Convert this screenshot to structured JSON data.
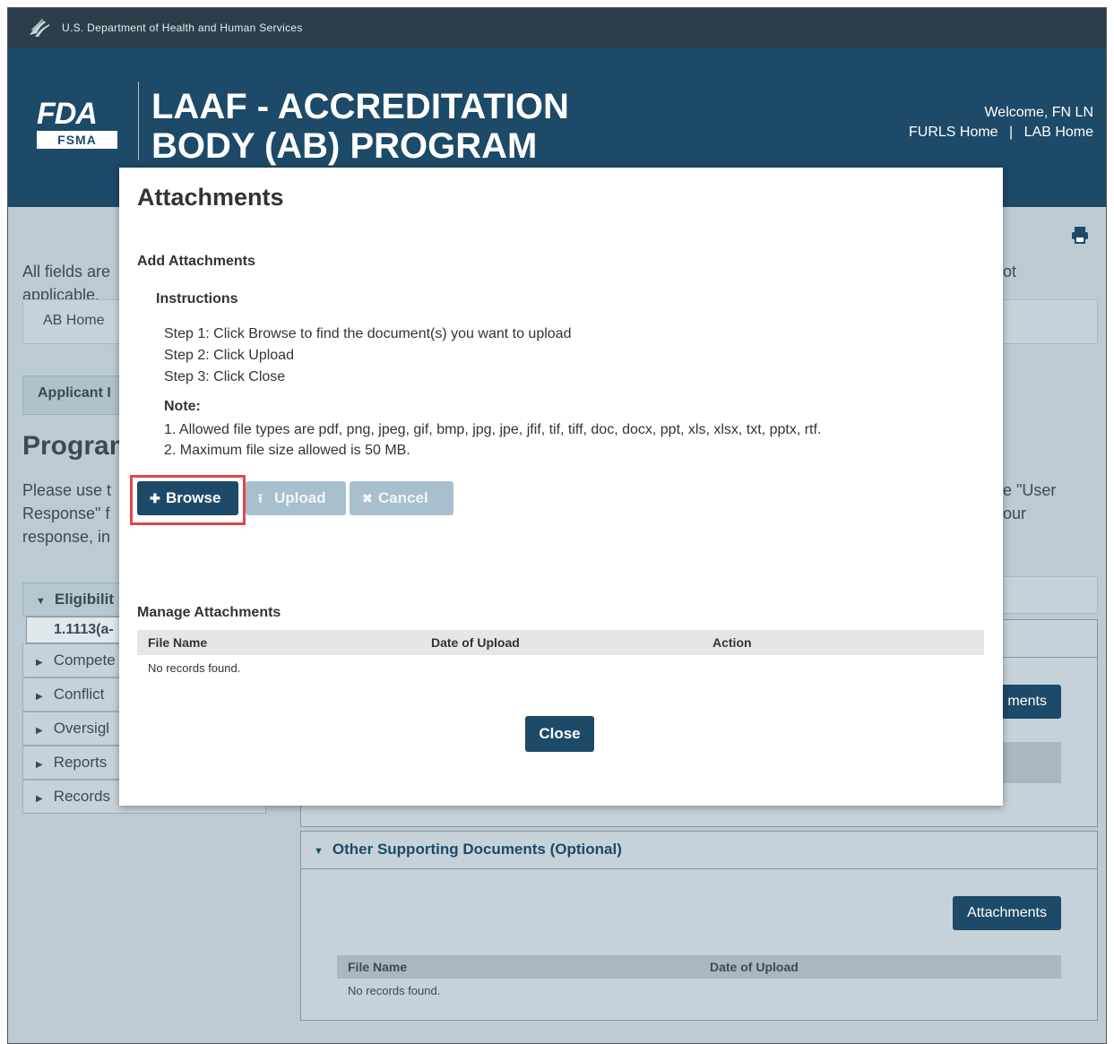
{
  "hhs_bar": {
    "text": "U.S. Department of Health and Human Services"
  },
  "header": {
    "logo_fda": "FDA",
    "logo_fsma": "FSMA",
    "title": "LAAF - ACCREDITATION BODY (AB) PROGRAM",
    "welcome": "Welcome, FN LN",
    "link_furls": "FURLS Home",
    "link_separator": "|",
    "link_lab": "LAB Home"
  },
  "background": {
    "fields_text_left": "All fields are",
    "fields_text_left2": "applicable.",
    "fields_text_right": "ot",
    "breadcrumb_home": "AB Home",
    "tab_applicant": "Applicant I",
    "section_title": "Program",
    "instr_line1_left": "Please use t",
    "instr_line1_right": "e \"User",
    "instr_line2_left": "Response\" f",
    "instr_line2_right": "our",
    "instr_line3_left": "response, in",
    "accordion": [
      {
        "label": "Eligibilit",
        "open": true
      },
      {
        "label": "Compete",
        "open": false
      },
      {
        "label": "Conflict",
        "open": false
      },
      {
        "label": "Oversigl",
        "open": false
      },
      {
        "label": "Reports",
        "open": false
      },
      {
        "label": "Records",
        "open": false
      }
    ],
    "accordion_sub": "1.1113(a-",
    "upper_attach_btn": "ments",
    "other_docs_title": "Other Supporting Documents (Optional)",
    "other_attach_btn": "Attachments",
    "other_table": {
      "col_file": "File Name",
      "col_date": "Date of Upload",
      "empty": "No records found."
    }
  },
  "modal": {
    "title": "Attachments",
    "add_label": "Add Attachments",
    "instructions_label": "Instructions",
    "steps": [
      "Step 1: Click Browse to find the document(s) you want to upload",
      "Step 2: Click Upload",
      "Step 3: Click Close"
    ],
    "note_label": "Note:",
    "notes": [
      "1. Allowed file types are pdf, png, jpeg, gif, bmp, jpg, jpe, jfif, tif, tiff, doc, docx, ppt, xls, xlsx, txt, pptx, rtf.",
      "2. Maximum file size allowed is 50 MB."
    ],
    "browse_label": "Browse",
    "upload_label": "Upload",
    "cancel_label": "Cancel",
    "manage_label": "Manage Attachments",
    "table": {
      "col_file": "File Name",
      "col_date": "Date of Upload",
      "col_action": "Action",
      "empty": "No records found."
    },
    "close_label": "Close"
  },
  "colors": {
    "header_bg": "#1c4a68",
    "hhs_bar_bg": "#2d3e4b",
    "primary_button": "#1c4a68",
    "highlight": "#e0474c"
  }
}
